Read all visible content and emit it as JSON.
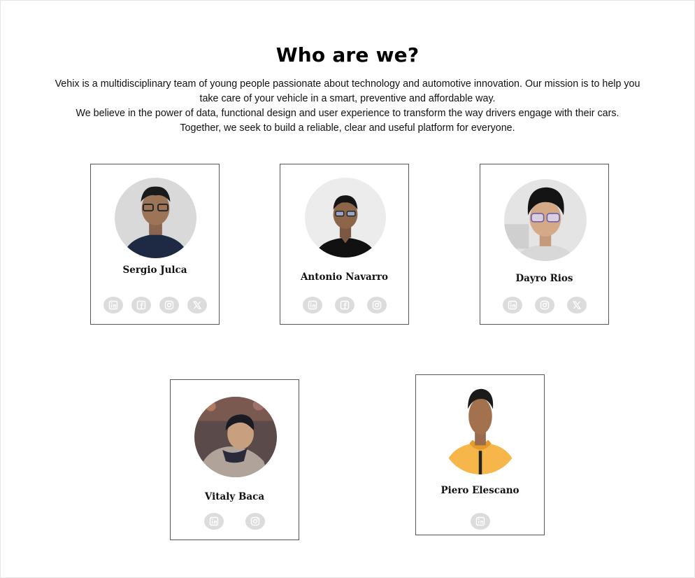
{
  "section": {
    "title": "Who are we?",
    "intro": [
      "Vehix is a multidisciplinary team of young people passionate about technology and automotive innovation. Our mission is to help you",
      "take care of your vehicle in a smart, preventive and affordable way.",
      "We believe in the power of data, functional design and user experience to transform the way drivers engage with their cars.",
      "Together, we seek to build a reliable, clear and useful platform for everyone."
    ]
  },
  "members": [
    {
      "name": "Sergio Julca",
      "socials": [
        "linkedin-icon",
        "facebook-icon",
        "instagram-icon",
        "x-icon"
      ]
    },
    {
      "name": "Antonio Navarro",
      "socials": [
        "linkedin-icon",
        "facebook-icon",
        "instagram-icon"
      ]
    },
    {
      "name": "Dayro Rios",
      "socials": [
        "linkedin-icon",
        "instagram-icon",
        "x-icon"
      ]
    },
    {
      "name": "Vitaly Baca",
      "socials": [
        "linkedin-icon",
        "instagram-icon"
      ]
    },
    {
      "name": "Piero Elescano",
      "socials": [
        "linkedin-icon"
      ]
    }
  ],
  "colors": {
    "icon_bg": "#dcdcdc",
    "icon_fg": "#ffffff",
    "card_border": "#555555"
  }
}
